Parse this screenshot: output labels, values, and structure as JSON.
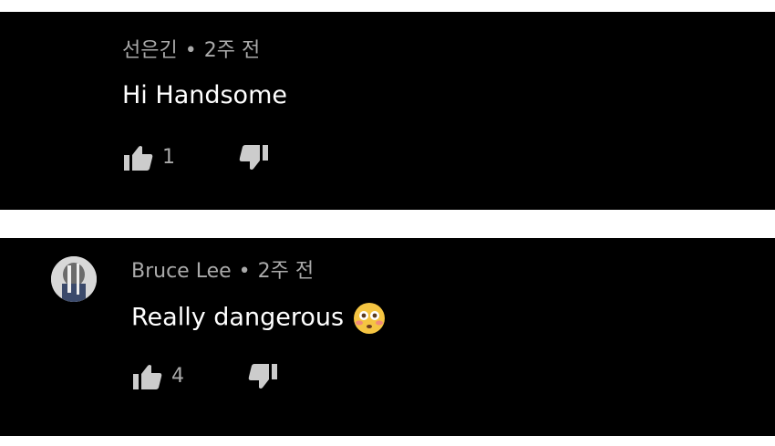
{
  "comments": [
    {
      "author": "선은긴",
      "time_ago": "2주 전",
      "separator": "•",
      "text": "Hi Handsome",
      "likes": "1"
    },
    {
      "author": "Bruce Lee",
      "time_ago": "2주 전",
      "separator": "•",
      "text": "Really dangerous",
      "likes": "4",
      "emoji": "flushed-face-emoji"
    }
  ],
  "colors": {
    "panel_background": "#000000",
    "page_background": "#ffffff",
    "meta_text": "#aaaaaa",
    "body_text": "#ffffff",
    "icon": "#cccccc"
  },
  "icons": {
    "like": "thumbs-up-icon",
    "dislike": "thumbs-down-icon"
  }
}
